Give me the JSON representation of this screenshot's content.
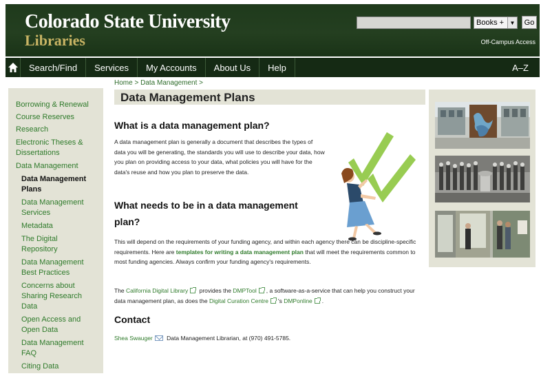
{
  "header": {
    "logo_line1": "Colorado State University",
    "logo_line2": "Libraries",
    "search": {
      "value": "",
      "placeholder": ""
    },
    "scope_select": "Books +",
    "go_label": "Go",
    "offcampus_label": "Off-Campus Access"
  },
  "nav": {
    "home_icon": "home-icon",
    "items": [
      "Search/Find",
      "Services",
      "My Accounts",
      "About Us",
      "Help"
    ],
    "az_label": "A–Z"
  },
  "breadcrumb": {
    "home": "Home",
    "sep1": " > ",
    "section": "Data Management",
    "sep2": " >"
  },
  "sidebar": {
    "items": [
      {
        "label": "Borrowing & Renewal"
      },
      {
        "label": "Course Reserves"
      },
      {
        "label": "Research"
      },
      {
        "label": "Electronic Theses & Dissertations"
      },
      {
        "label": "Data Management"
      },
      {
        "label": "Data Management Plans"
      },
      {
        "label": "Data Management Services"
      },
      {
        "label": "Metadata"
      },
      {
        "label": "The Digital Repository"
      },
      {
        "label": "Data Management Best Practices"
      },
      {
        "label": "Concerns about Sharing Research Data"
      },
      {
        "label": "Open Access and Open Data"
      },
      {
        "label": "Data Management FAQ"
      },
      {
        "label": "Citing Data"
      }
    ]
  },
  "main": {
    "title": "Data Management Plans",
    "h_what": "What is a data management plan?",
    "p_what": "A data management plan is generally a document that describes the types of data you will be generating, the standards you will use to describe your data, how you plan on providing access to your data, what policies you will have for the data's reuse and how you plan to preserve the data.",
    "h_needs": "What needs to be in a data management plan?",
    "p_needs_a": "This will depend on the requirements of your funding agency, and within each agency there can be discipline-specific requirements. Here are ",
    "p_needs_link": "templates for writing a data management plan",
    "p_needs_b": " that will meet the requirements common to most funding agencies. Always confirm your funding agency's requirements.",
    "p_tools": {
      "t1": "The ",
      "cdl": "California Digital Library",
      "t2": " provides the ",
      "dmptool": "DMPTool",
      "t3": ", a software-as-a-service that can help you construct your data management plan, as does the ",
      "dcc": "Digital Curation Centre",
      "t4": "'s ",
      "dmponline": "DMPonline",
      "t5": "."
    },
    "h_contact": "Contact",
    "contact": {
      "name": "Shea Swauger",
      "rest": " Data Management Librarian, at (970) 491-5785."
    }
  },
  "colors": {
    "header_green": "#243f20",
    "nav_dark": "#152a14",
    "link_green": "#2e7a2a",
    "panel_beige": "#e3e3d6",
    "logo_gold": "#c8b464"
  }
}
